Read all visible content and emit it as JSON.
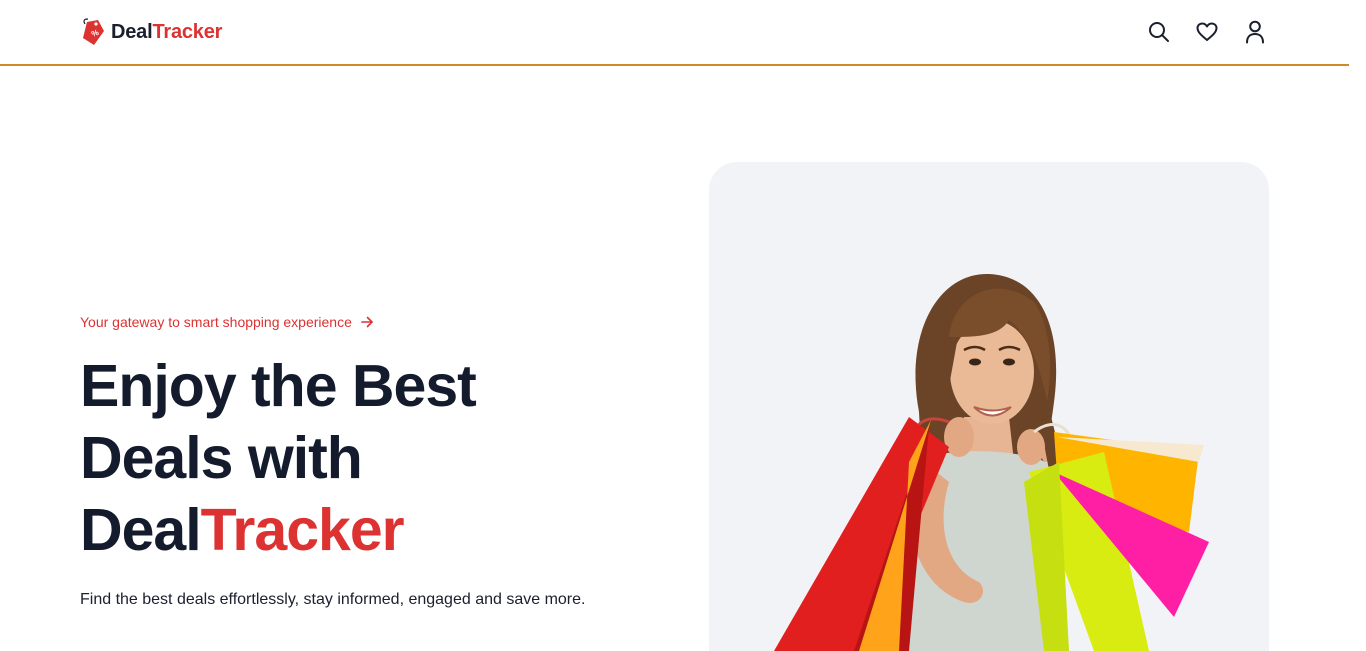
{
  "brand": {
    "name_part1": "Deal",
    "name_part2": "Tracker",
    "accent_color": "#dc3232",
    "header_border_color": "#d08a2c"
  },
  "header": {
    "icons": [
      "search-icon",
      "heart-icon",
      "user-icon"
    ]
  },
  "hero": {
    "tagline": "Your gateway to smart shopping experience",
    "headline_line1": "Enjoy the Best",
    "headline_line2": "Deals with",
    "headline_part_dark": "Deal",
    "headline_part_red": "Tracker",
    "subtext": "Find the best deals effortlessly, stay informed, engaged and save more.",
    "image_subject": "woman-with-shopping-bags"
  }
}
